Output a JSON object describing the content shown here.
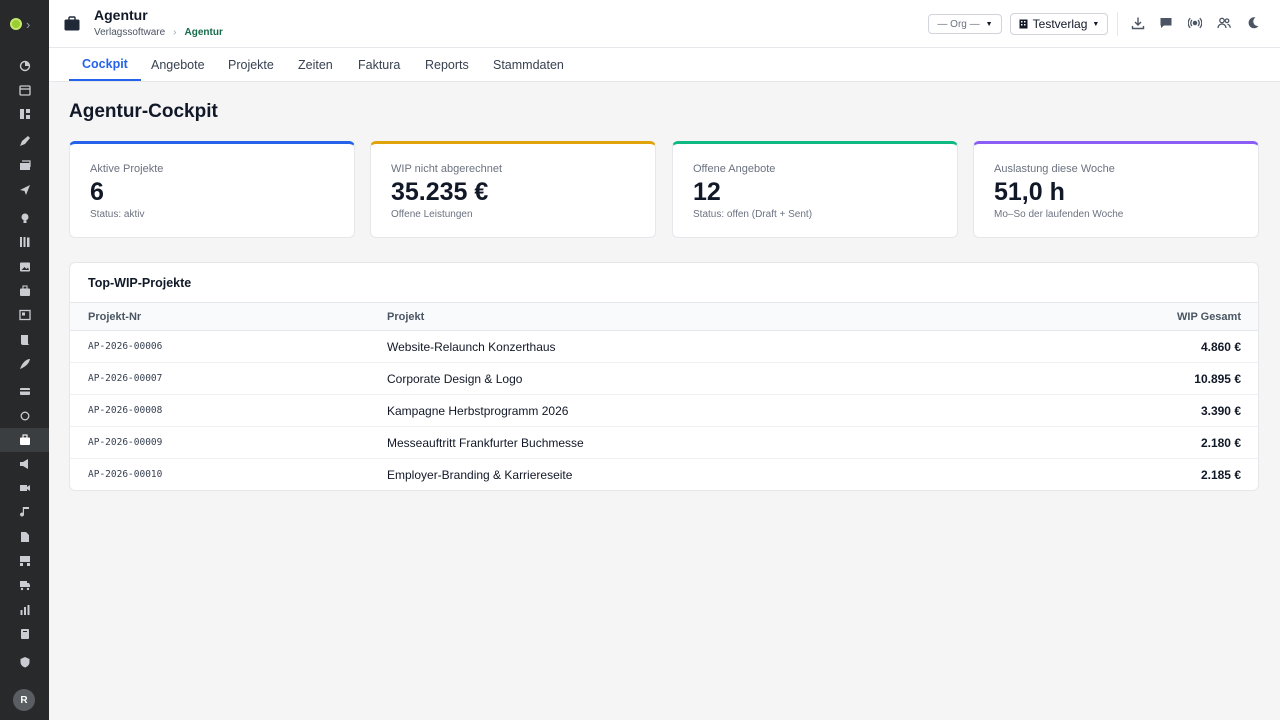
{
  "header": {
    "title": "Agentur",
    "breadcrumb": [
      "Verlagssoftware",
      "Agentur"
    ],
    "org_select": "— Org —",
    "verlag_select": "Testverlag"
  },
  "tabs": [
    "Cockpit",
    "Angebote",
    "Projekte",
    "Zeiten",
    "Faktura",
    "Reports",
    "Stammdaten"
  ],
  "page": {
    "title": "Agentur-Cockpit"
  },
  "kpis": [
    {
      "label": "Aktive Projekte",
      "value": "6",
      "sub": "Status: aktiv",
      "color": "#2563eb"
    },
    {
      "label": "WIP nicht abgerechnet",
      "value": "35.235 €",
      "sub": "Offene Leistungen",
      "color": "#e0a30b"
    },
    {
      "label": "Offene Angebote",
      "value": "12",
      "sub": "Status: offen (Draft + Sent)",
      "color": "#10b981"
    },
    {
      "label": "Auslastung diese Woche",
      "value": "51,0 h",
      "sub": "Mo–So der laufenden Woche",
      "color": "#8b5cf6"
    }
  ],
  "top_wip": {
    "title": "Top-WIP-Projekte",
    "columns": [
      "Projekt-Nr",
      "Projekt",
      "WIP Gesamt"
    ],
    "rows": [
      {
        "nr": "AP-2026-00006",
        "name": "Website-Relaunch Konzerthaus",
        "wip": "4.860 €"
      },
      {
        "nr": "AP-2026-00007",
        "name": "Corporate Design & Logo",
        "wip": "10.895 €"
      },
      {
        "nr": "AP-2026-00008",
        "name": "Kampagne Herbstprogramm 2026",
        "wip": "3.390 €"
      },
      {
        "nr": "AP-2026-00009",
        "name": "Messeauftritt Frankfurter Buchmesse",
        "wip": "2.180 €"
      },
      {
        "nr": "AP-2026-00010",
        "name": "Employer-Branding & Karriereseite",
        "wip": "2.185 €"
      }
    ]
  },
  "sidebar": {
    "icons": [
      "dashboard-icon",
      "calendar-icon",
      "grid-icon",
      "edit-icon",
      "stack-icon",
      "send-icon",
      "bulb-icon",
      "library-icon",
      "image-icon",
      "briefcase-icon",
      "news-icon",
      "scroll-icon",
      "feather-icon",
      "wallet-icon",
      "circle-icon",
      "agency-icon",
      "megaphone-icon",
      "video-icon",
      "music-icon",
      "file-icon",
      "store-icon",
      "truck-icon",
      "chart-icon",
      "document-icon",
      "shield-icon"
    ],
    "active": "agency-icon",
    "avatar": "R"
  },
  "colors": {
    "accent": "#2563eb",
    "breadcrumb_active": "#166c4a",
    "sidebar_bg": "#27292b"
  }
}
